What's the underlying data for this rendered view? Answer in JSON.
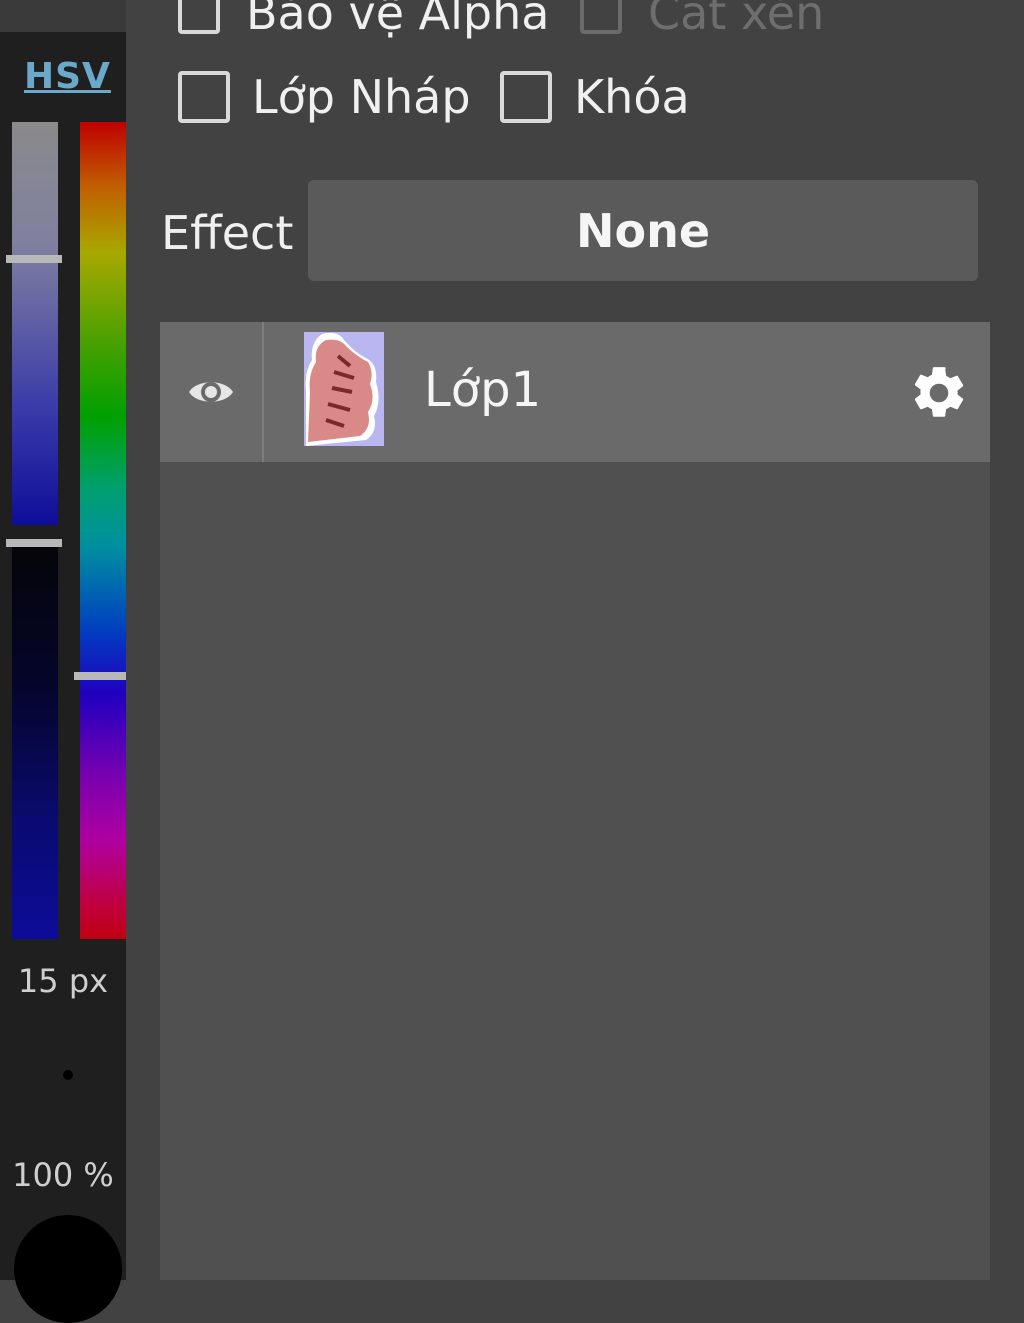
{
  "color_panel": {
    "mode": "HSV",
    "brush_size": "15 px",
    "opacity": "100 %",
    "current_color": "#000000"
  },
  "layer_options": {
    "protect_alpha": "Bảo vệ Alpha",
    "clipping": "Cắt xén",
    "draft_layer": "Lớp Nháp",
    "lock": "Khóa"
  },
  "effect": {
    "label": "Effect",
    "value": "None"
  },
  "layers": [
    {
      "name": "Lớp1",
      "visible": true
    }
  ],
  "icons": {
    "visibility": "eye-icon",
    "settings": "gear-icon"
  },
  "colors": {
    "background": "#424242",
    "panel": "#1f1f1f",
    "accent_link": "#6aa9c9",
    "selected_layer": "#6a6a6a"
  }
}
